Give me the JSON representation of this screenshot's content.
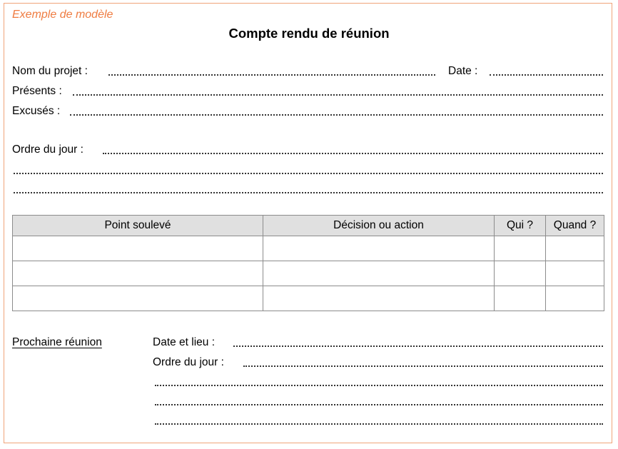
{
  "template_tag": "Exemple de modèle",
  "title": "Compte rendu de réunion",
  "fields": {
    "project_name": "Nom du projet :",
    "date": "Date :",
    "present": "Présents :",
    "excused": "Excusés :",
    "agenda": "Ordre du jour :"
  },
  "table": {
    "headers": [
      "Point soulevé",
      "Décision ou action",
      "Qui ?",
      "Quand ?"
    ],
    "rows": [
      [
        "",
        "",
        "",
        ""
      ],
      [
        "",
        "",
        "",
        ""
      ],
      [
        "",
        "",
        "",
        ""
      ]
    ]
  },
  "next_meeting": {
    "heading": "Prochaine réunion",
    "date_place": "Date et lieu :",
    "agenda": "Ordre du jour :"
  },
  "colors": {
    "accent": "#ef7c41",
    "frame": "#f0a47a",
    "table_header_bg": "#e0e0e0"
  }
}
